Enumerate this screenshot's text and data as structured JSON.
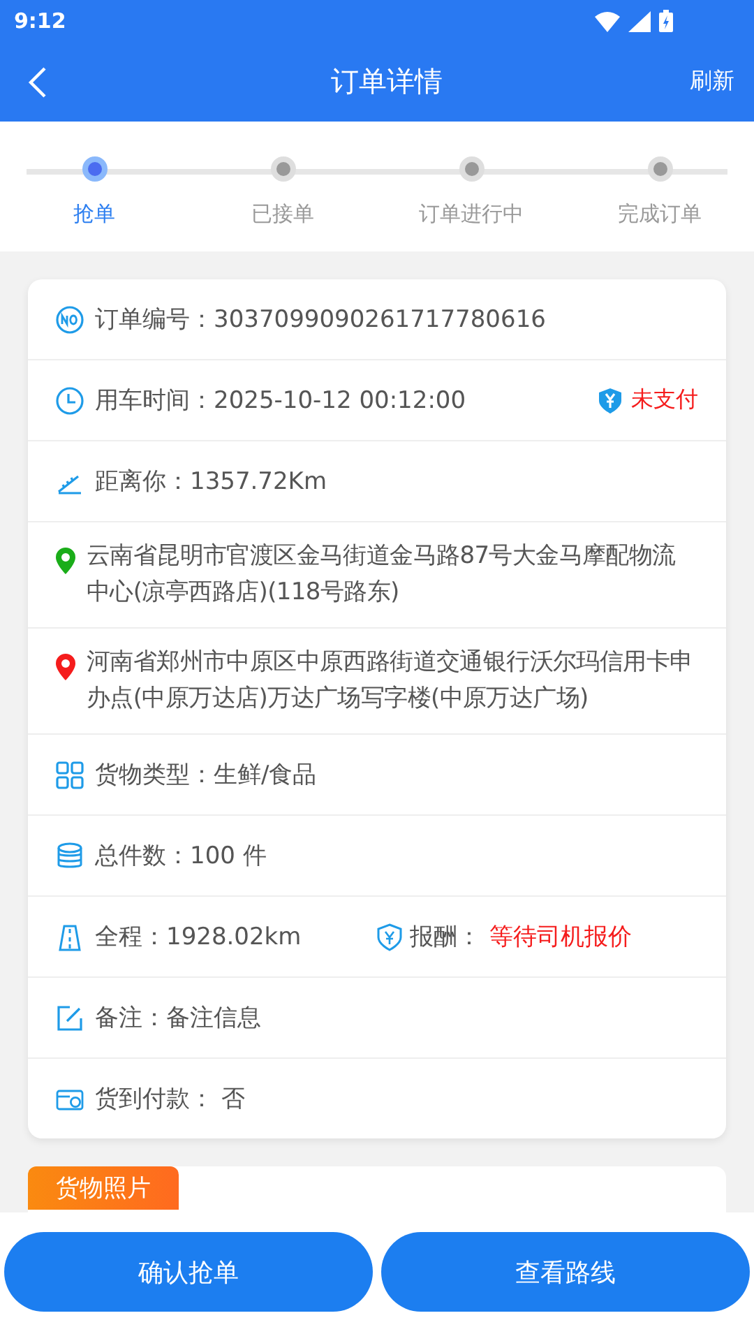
{
  "status_bar": {
    "time": "9:12"
  },
  "header": {
    "title": "订单详情",
    "action": "刷新"
  },
  "steps": [
    {
      "label": "抢单",
      "selected": true
    },
    {
      "label": "已接单",
      "selected": false
    },
    {
      "label": "订单进行中",
      "selected": false
    },
    {
      "label": "完成订单",
      "selected": false
    }
  ],
  "rows": [
    {
      "kind": "field",
      "label": "订单编号：",
      "value": "3037099090261717780616"
    },
    {
      "kind": "field",
      "label": "用车时间：",
      "value": "2025-10-12 00:12:00",
      "status": "未支付"
    },
    {
      "kind": "field",
      "label": "距离你：",
      "value": "1357.72Km"
    },
    {
      "kind": "address",
      "text": "云南省昆明市官渡区金马街道金马路87号大金马摩配物流中心(凉亭西路店)(118号路东)",
      "color": "#1aad19"
    },
    {
      "kind": "address",
      "text": "河南省郑州市中原区中原西路街道交通银行沃尔玛信用卡申办点(中原万达店)万达广场写字楼(中原万达广场)",
      "color": "#f51c1c"
    },
    {
      "kind": "field",
      "label": "货物类型：",
      "value": "生鲜/食品"
    },
    {
      "kind": "field",
      "label": "总件数：",
      "value": "100 件"
    },
    {
      "kind": "field",
      "label": "全程：",
      "value": "1928.02km",
      "extra_label": "报酬：",
      "extra_value": "等待司机报价"
    },
    {
      "kind": "field",
      "label": "备注：",
      "value": "备注信息"
    },
    {
      "kind": "field",
      "label": "货到付款：",
      "value": " 否"
    }
  ],
  "photos": {
    "title": "货物照片"
  },
  "buttons": [
    "确认抢单",
    "查看路线"
  ]
}
